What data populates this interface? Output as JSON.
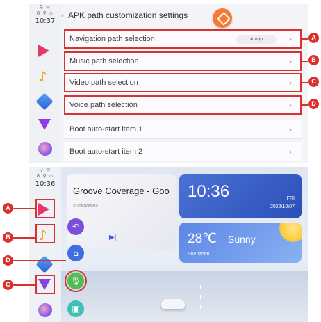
{
  "top_screen": {
    "status_icons": "⚲ ᯤ",
    "status_icons2": "8 ⚲ ◇",
    "time": "10:37",
    "title": "APK path customization settings",
    "rows": [
      {
        "label": "Navigation path selection",
        "value": "Amap"
      },
      {
        "label": "Music path selection"
      },
      {
        "label": "Video path selection"
      },
      {
        "label": "Voice path selection"
      },
      {
        "label": "Boot auto-start item 1"
      },
      {
        "label": "Boot auto-start item 2"
      }
    ],
    "arrow": "›",
    "back": "‹"
  },
  "callouts": {
    "a": "A",
    "b": "B",
    "c": "C",
    "d": "D"
  },
  "bottom_screen": {
    "time": "10:36",
    "music_title": "Groove Coverage - Goo",
    "music_artist": "<unknown>",
    "clock": "10:36",
    "day": "FRI",
    "date": "2022\\10\\07",
    "temperature": "28℃",
    "condition": "Sunny",
    "city": "Shenzhen"
  },
  "colors": {
    "callout": "#d9322e",
    "accent_orange": "#f57a33"
  }
}
